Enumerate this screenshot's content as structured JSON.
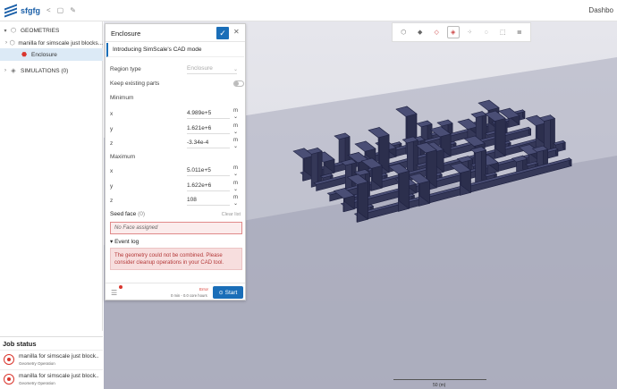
{
  "project": {
    "title": "sfgfg",
    "icons": [
      "share-icon",
      "window-icon",
      "edit-icon"
    ]
  },
  "header": {
    "dashboard_label": "Dashbo"
  },
  "tree": {
    "geometries_label": "GEOMETRIES",
    "geometry_item": "manilla for simscale just blocks...",
    "enclosure_item": "Enclosure",
    "simulations_label": "SIMULATIONS (0)"
  },
  "panel": {
    "title": "Enclosure",
    "cad_mode_label": "Introducing SimScale's CAD mode",
    "region_type_label": "Region type",
    "region_type_value": "Enclosure",
    "keep_parts_label": "Keep existing parts",
    "minimum_label": "Minimum",
    "maximum_label": "Maximum",
    "min": [
      {
        "axis": "x",
        "value": "4.989e+5",
        "unit": "m"
      },
      {
        "axis": "y",
        "value": "1.621e+6",
        "unit": "m"
      },
      {
        "axis": "z",
        "value": "-3.34e-4",
        "unit": "m"
      }
    ],
    "max": [
      {
        "axis": "x",
        "value": "5.011e+5",
        "unit": "m"
      },
      {
        "axis": "y",
        "value": "1.622e+6",
        "unit": "m"
      },
      {
        "axis": "z",
        "value": "108",
        "unit": "m"
      }
    ],
    "seed_face_label": "Seed face",
    "seed_face_count": "(0)",
    "clear_list_label": "Clear list",
    "no_face_label": "No Face assigned",
    "event_log_label": "Event log",
    "error_message": "The geometry could not be combined. Please consider cleanup operations in your CAD tool.",
    "footer": {
      "status_label": "Error",
      "time_label": "0 min - 0.0 core hours",
      "start_label": "Start"
    }
  },
  "job_status": {
    "title": "Job status",
    "jobs": [
      {
        "name": "manilla for simscale just block...",
        "type": "Geometry Operation"
      },
      {
        "name": "manilla for simscale just block...",
        "type": "Geometry Operation"
      }
    ]
  },
  "viewport": {
    "scale_label": "50 (m)"
  },
  "colors": {
    "accent": "#1a6eb8",
    "error": "#d9362e",
    "model": "#3b3f63"
  }
}
